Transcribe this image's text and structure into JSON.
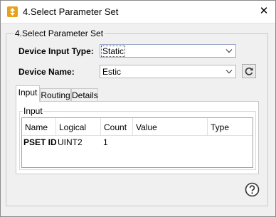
{
  "window": {
    "title": "4.Select Parameter Set",
    "close_glyph": "✕",
    "icon": "app-icon"
  },
  "group": {
    "legend": "4.Select Parameter Set"
  },
  "fields": {
    "device_input_type": {
      "label": "Device Input Type:",
      "value": "Static"
    },
    "device_name": {
      "label": "Device Name:",
      "value": "Estic"
    }
  },
  "tabs": [
    {
      "label": "Input",
      "active": true
    },
    {
      "label": "Routing",
      "active": false
    },
    {
      "label": "Details",
      "active": false
    }
  ],
  "input_panel": {
    "legend": "Input",
    "columns": [
      "Name",
      "Logical",
      "Count",
      "Value",
      "Type"
    ],
    "rows": [
      {
        "name": "PSET ID",
        "logical": "UINT2",
        "count": "1",
        "value": "",
        "type": ""
      }
    ]
  },
  "icons": {
    "refresh": "refresh-icon",
    "help": "help-icon",
    "dropdown": "chevron-down-icon"
  },
  "colors": {
    "app_icon": "#e8a21a",
    "window_bg": "#f0f0f0",
    "titlebar_bg": "#ffffff"
  }
}
